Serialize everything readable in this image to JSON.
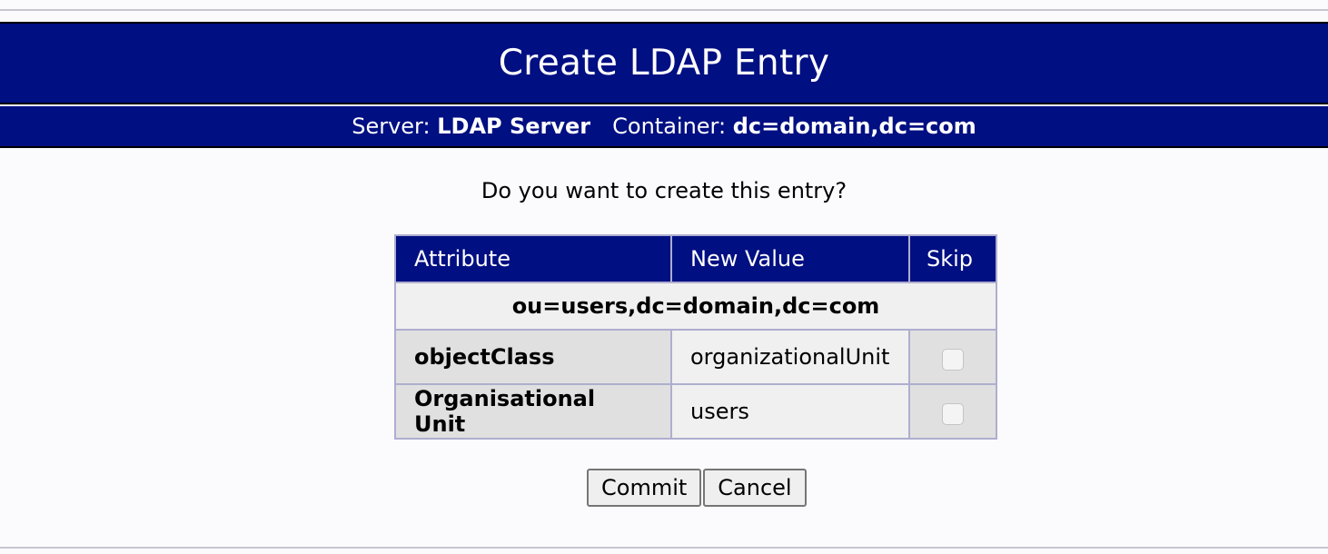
{
  "header": {
    "title": "Create LDAP Entry",
    "server_label": "Server:",
    "server_value": "LDAP Server",
    "container_label": "Container:",
    "container_value": "dc=domain,dc=com"
  },
  "prompt": "Do you want to create this entry?",
  "table": {
    "columns": [
      "Attribute",
      "New Value",
      "Skip"
    ],
    "dn": "ou=users,dc=domain,dc=com",
    "rows": [
      {
        "attribute": "objectClass",
        "value": "organizationalUnit",
        "skip": false
      },
      {
        "attribute": "Organisational Unit",
        "value": "users",
        "skip": false
      }
    ]
  },
  "actions": {
    "commit_label": "Commit",
    "cancel_label": "Cancel"
  },
  "colors": {
    "header_bg": "#000f82",
    "page_bg": "#fbfbfe",
    "table_border": "#aeaed0"
  }
}
